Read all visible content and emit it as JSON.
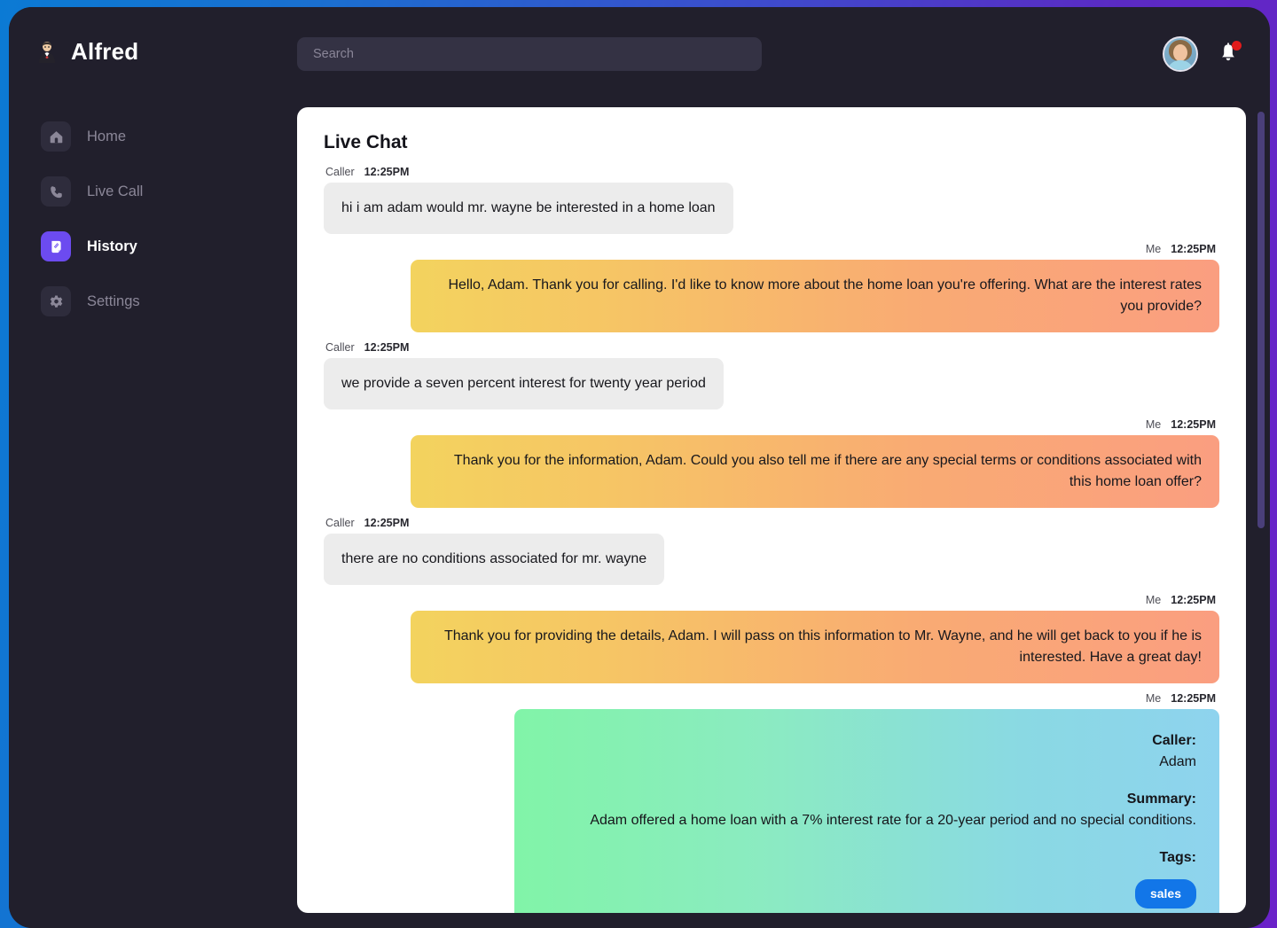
{
  "brand": {
    "logo_icon": "butler-icon",
    "name": "Alfred"
  },
  "search": {
    "placeholder": "Search",
    "value": ""
  },
  "topbar": {
    "avatar_name": "user-avatar",
    "bell_icon": "notification-bell-icon",
    "has_unread": true
  },
  "sidebar": {
    "items": [
      {
        "label": "Home",
        "icon": "home-icon",
        "active": false
      },
      {
        "label": "Live Call",
        "icon": "phone-icon",
        "active": false
      },
      {
        "label": "History",
        "icon": "document-icon",
        "active": true
      },
      {
        "label": "Settings",
        "icon": "gear-icon",
        "active": false
      }
    ]
  },
  "chat": {
    "title": "Live Chat",
    "messages": [
      {
        "sender": "Caller",
        "time": "12:25PM",
        "side": "left",
        "text": "hi i am adam would mr. wayne be interested in a home loan"
      },
      {
        "sender": "Me",
        "time": "12:25PM",
        "side": "right",
        "text": "Hello, Adam. Thank you for calling. I'd like to know more about the home loan you're offering. What are the interest rates you provide?"
      },
      {
        "sender": "Caller",
        "time": "12:25PM",
        "side": "left",
        "text": "we provide a seven percent interest for twenty year period"
      },
      {
        "sender": "Me",
        "time": "12:25PM",
        "side": "right",
        "text": "Thank you for the information, Adam. Could you also tell me if there are any special terms or conditions associated with this home loan offer?"
      },
      {
        "sender": "Caller",
        "time": "12:25PM",
        "side": "left",
        "text": "there are no conditions associated for mr. wayne"
      },
      {
        "sender": "Me",
        "time": "12:25PM",
        "side": "right",
        "text": "Thank you for providing the details, Adam. I will pass on this information to Mr. Wayne, and he will get back to you if he is interested. Have a great day!"
      }
    ],
    "summary_card": {
      "sender": "Me",
      "time": "12:25PM",
      "caller_label": "Caller:",
      "caller_value": "Adam",
      "summary_label": "Summary:",
      "summary_value": "Adam offered a home loan with a 7% interest rate for a 20-year period and no special conditions.",
      "tags_label": "Tags:",
      "tags": [
        "sales"
      ]
    }
  },
  "colors": {
    "frame_start": "#0b7ad4",
    "frame_end": "#6a22c9",
    "app_bg": "#211f2c",
    "active_nav": "#6c4bf0",
    "me_bubble_start": "#f3d35e",
    "me_bubble_end": "#fa9e80",
    "caller_bubble": "#ececec",
    "summary_start": "#81f4a8",
    "summary_end": "#8ed3ee",
    "tag_bg": "#1276e8",
    "notification_dot": "#e11b1b"
  }
}
